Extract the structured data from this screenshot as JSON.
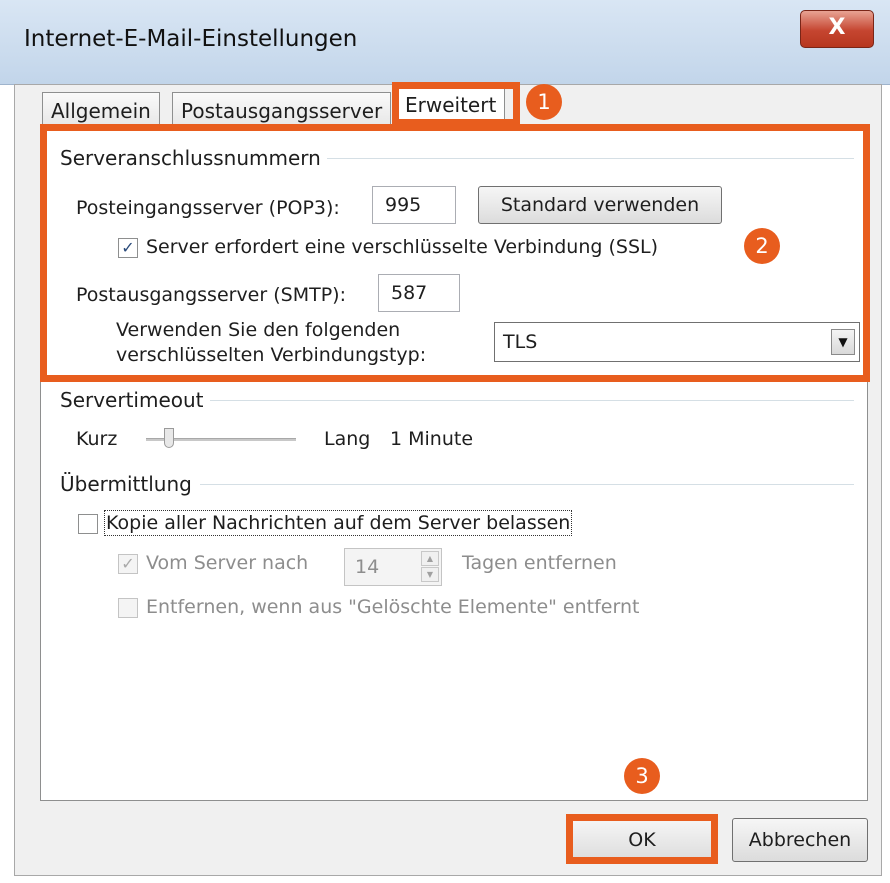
{
  "window": {
    "title": "Internet-E-Mail-Einstellungen",
    "close_glyph": "X"
  },
  "tabs": [
    {
      "label": "Allgemein",
      "active": false
    },
    {
      "label": "Postausgangsserver",
      "active": false
    },
    {
      "label": "Erweitert",
      "active": true
    }
  ],
  "server_ports": {
    "group_title": "Serveranschlussnummern",
    "incoming_label": "Posteingangsserver (POP3):",
    "incoming_value": "995",
    "default_button": "Standard verwenden",
    "ssl_checkbox_label": "Server erfordert eine verschlüsselte Verbindung (SSL)",
    "ssl_checked": true,
    "outgoing_label": "Postausgangsserver (SMTP):",
    "outgoing_value": "587",
    "encryption_label_line1": "Verwenden Sie den folgenden",
    "encryption_label_line2": "verschlüsselten Verbindungstyp:",
    "encryption_value": "TLS"
  },
  "timeout": {
    "group_title": "Servertimeout",
    "short_label": "Kurz",
    "long_label": "Lang",
    "value_text": "1 Minute"
  },
  "delivery": {
    "group_title": "Übermittlung",
    "keep_copy_label": "Kopie aller Nachrichten auf dem Server belassen",
    "keep_copy_checked": false,
    "remove_after_label": "Vom Server nach",
    "remove_after_checked": true,
    "days_value": "14",
    "days_suffix": "Tagen entfernen",
    "remove_deleted_label": "Entfernen, wenn aus \"Gelöschte Elemente\" entfernt",
    "remove_deleted_checked": false
  },
  "footer": {
    "ok_label": "OK",
    "cancel_label": "Abbrechen"
  },
  "annotations": {
    "badge1": "1",
    "badge2": "2",
    "badge3": "3",
    "highlight_color": "#e85d1e"
  },
  "colors": {
    "highlight": "#e85d1e",
    "titlebar": "#c9dbef",
    "close_button": "#c54530"
  }
}
